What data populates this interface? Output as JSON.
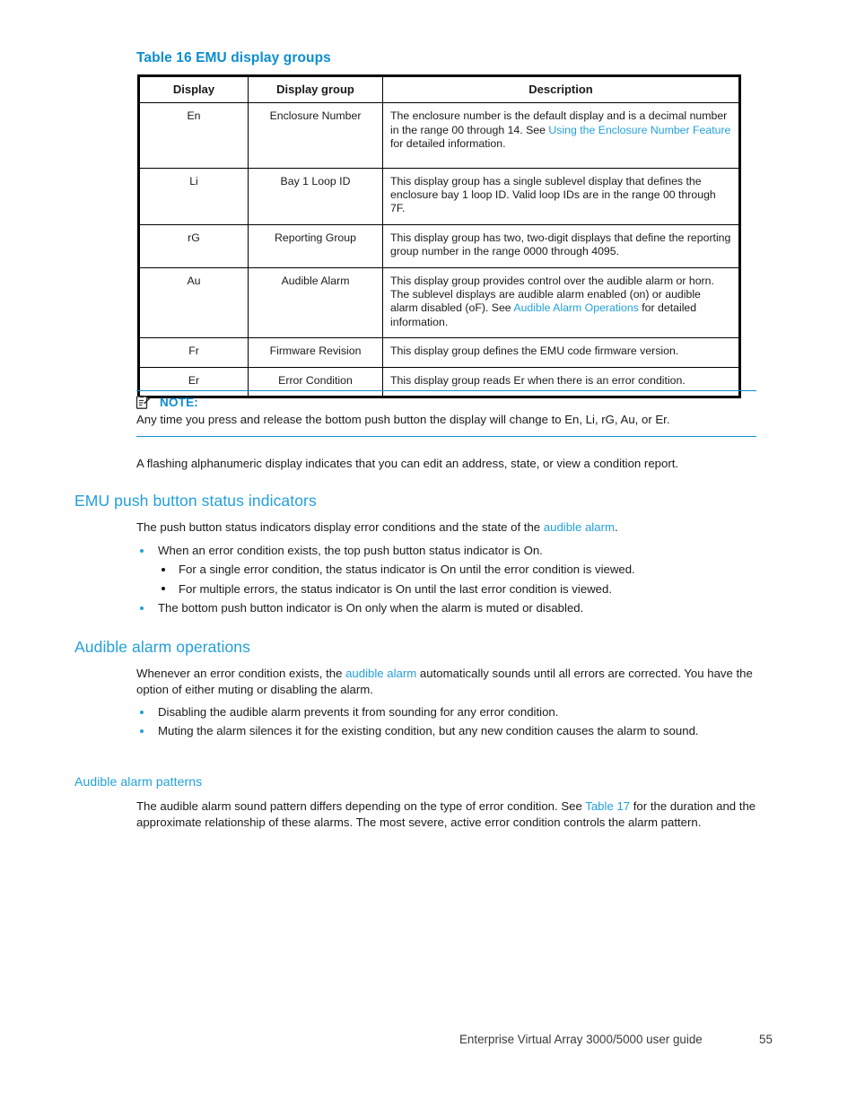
{
  "table": {
    "caption": "Table 16 EMU display groups",
    "headers": [
      "Display",
      "Display group",
      "Description"
    ],
    "rows": [
      {
        "display": "En",
        "group": "Enclosure Number",
        "desc_pre": "The enclosure number is the default display and is a decimal number in the range 00 through 14. See ",
        "desc_link": "Using the Enclosure Number Feature",
        "desc_post": " for detailed information."
      },
      {
        "display": "Li",
        "group": "Bay 1 Loop ID",
        "desc_pre": "This display group has a single sublevel display that defines the enclosure bay 1 loop ID. Valid loop IDs are in the range 00 through 7F.",
        "desc_link": "",
        "desc_post": ""
      },
      {
        "display": "rG",
        "group": "Reporting Group",
        "desc_pre": "This display group has two, two-digit displays that define the reporting group number in the range 0000 through 4095.",
        "desc_link": "",
        "desc_post": ""
      },
      {
        "display": "Au",
        "group": "Audible Alarm",
        "desc_pre": "This display group provides control over the audible alarm or horn. The sublevel displays are audible alarm enabled (on) or audible alarm disabled (oF). See ",
        "desc_link": "Audible Alarm Operations",
        "desc_post": " for detailed information."
      },
      {
        "display": "Fr",
        "group": "Firmware Revision",
        "desc_pre": "This display group defines the EMU code firmware version.",
        "desc_link": "",
        "desc_post": ""
      },
      {
        "display": "Er",
        "group": "Error Condition",
        "desc_pre": "This display group reads Er when there is an error condition.",
        "desc_link": "",
        "desc_post": ""
      }
    ]
  },
  "note": {
    "icon": "note-clipboard-icon",
    "label": "NOTE:",
    "text": "Any time you press and release the bottom push button the display will change to En, Li, rG, Au, or Er."
  },
  "flashing_paragraph": "A flashing alphanumeric display indicates that you can edit an address, state, or view a condition report.",
  "push_button_section": {
    "heading": "EMU push button status indicators",
    "intro_pre": "The push button status indicators display error conditions and the state of the ",
    "intro_link": "audible alarm",
    "intro_post": ".",
    "bullets": [
      {
        "level": 1,
        "text": "When an error condition exists, the top push button status indicator is On."
      },
      {
        "level": 2,
        "text": "For a single error condition, the status indicator is On until the error condition is viewed."
      },
      {
        "level": 2,
        "text": "For multiple errors, the status indicator is On until the last error condition is viewed."
      },
      {
        "level": 1,
        "text": "The bottom push button indicator is On only when the alarm is muted or disabled."
      }
    ]
  },
  "audible_alarm_section": {
    "heading": "Audible alarm operations",
    "intro_pre": "Whenever an error condition exists, the ",
    "intro_link": "audible alarm",
    "intro_post": " automatically sounds until all errors are corrected. You have the option of either muting or disabling the alarm.",
    "bullets": [
      {
        "level": 1,
        "text": "Disabling the audible alarm prevents it from sounding for any error condition."
      },
      {
        "level": 1,
        "text": "Muting the alarm silences it for the existing condition, but any new condition causes the alarm to sound."
      }
    ]
  },
  "patterns_section": {
    "heading": "Audible alarm patterns",
    "text_pre": "The audible alarm sound pattern differs depending on the type of error condition. See ",
    "text_link": "Table 17",
    "text_post": " for the duration and the approximate relationship of these alarms. The most severe, active error condition controls the alarm pattern."
  },
  "footer": {
    "title": "Enterprise Virtual Array 3000/5000 user guide",
    "page_number": "55"
  },
  "colors": {
    "heading_blue": "#22a0da",
    "caption_blue": "#0c8dd0",
    "link_blue": "#22a0da",
    "text": "#1a1a1a",
    "table_border": "#000000"
  }
}
